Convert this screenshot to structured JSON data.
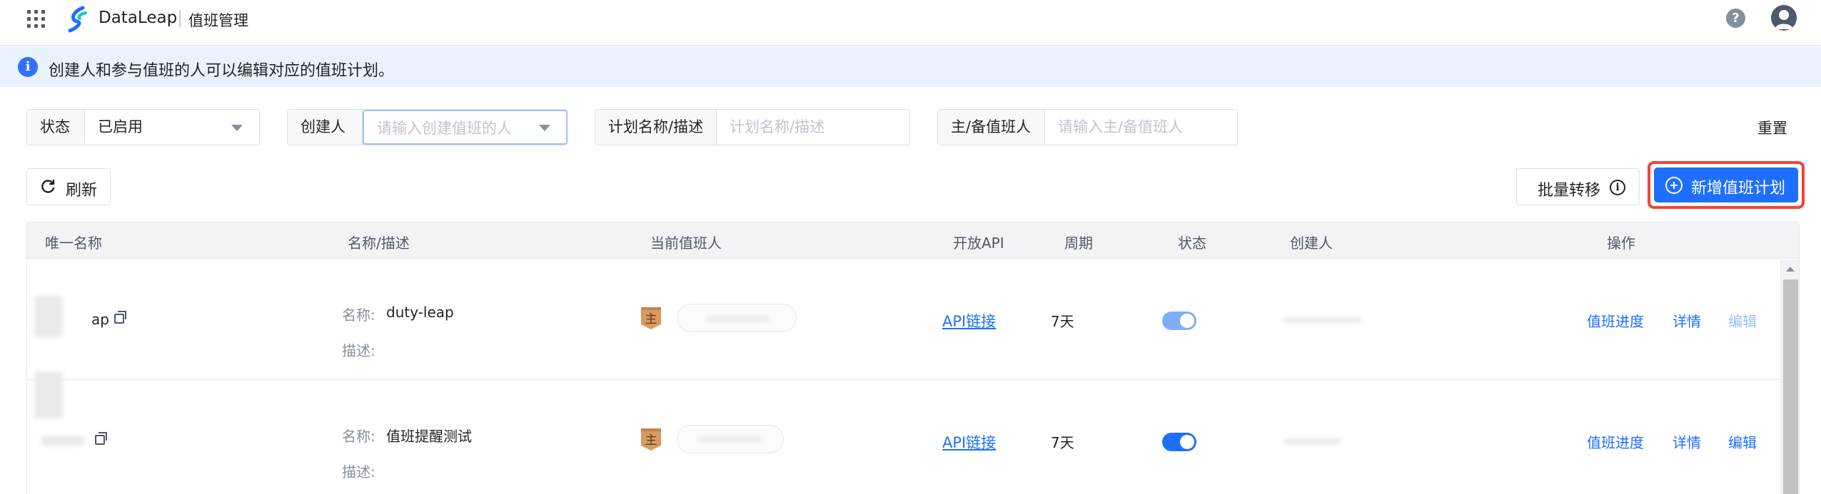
{
  "header": {
    "brand": "DataLeap",
    "breadcrumb": "值班管理",
    "help_icon": "question-circle-icon",
    "user_icon": "user-avatar-icon"
  },
  "alert": {
    "text": "创建人和参与值班的人可以编辑对应的值班计划。"
  },
  "filters": {
    "status_label": "状态",
    "status_value": "已启用",
    "creator_label": "创建人",
    "creator_placeholder": "请输入创建值班的人",
    "plan_label": "计划名称/描述",
    "plan_placeholder": "计划名称/描述",
    "oncall_label": "主/备值班人",
    "oncall_placeholder": "请输入主/备值班人",
    "reset_label": "重置"
  },
  "toolbar": {
    "refresh_label": "刷新",
    "batch_label": "批量转移",
    "new_label": "新增值班计划"
  },
  "table": {
    "columns": [
      "唯一名称",
      "名称/描述",
      "当前值班人",
      "开放API",
      "周期",
      "状态",
      "创建人",
      "操作"
    ],
    "rows": [
      {
        "unique_name": "ap",
        "name_label": "名称:",
        "name_value": "duty-leap",
        "desc_label": "描述:",
        "desc_value": "",
        "badge": "主",
        "api_link": "API链接",
        "period": "7天",
        "enabled": true,
        "ops": [
          "值班进度",
          "详情",
          "编辑"
        ],
        "edit_disabled": true
      },
      {
        "unique_name": "",
        "name_label": "名称:",
        "name_value": "值班提醒测试",
        "desc_label": "描述:",
        "desc_value": "",
        "badge": "主",
        "api_link": "API链接",
        "period": "7天",
        "enabled": true,
        "ops": [
          "值班进度",
          "详情",
          "编辑"
        ],
        "edit_disabled": false
      }
    ]
  },
  "colors": {
    "primary": "#1e6fff",
    "alert_bg": "#e8f3ff",
    "highlight_border": "#f04438",
    "badge": "#d99a5e"
  }
}
